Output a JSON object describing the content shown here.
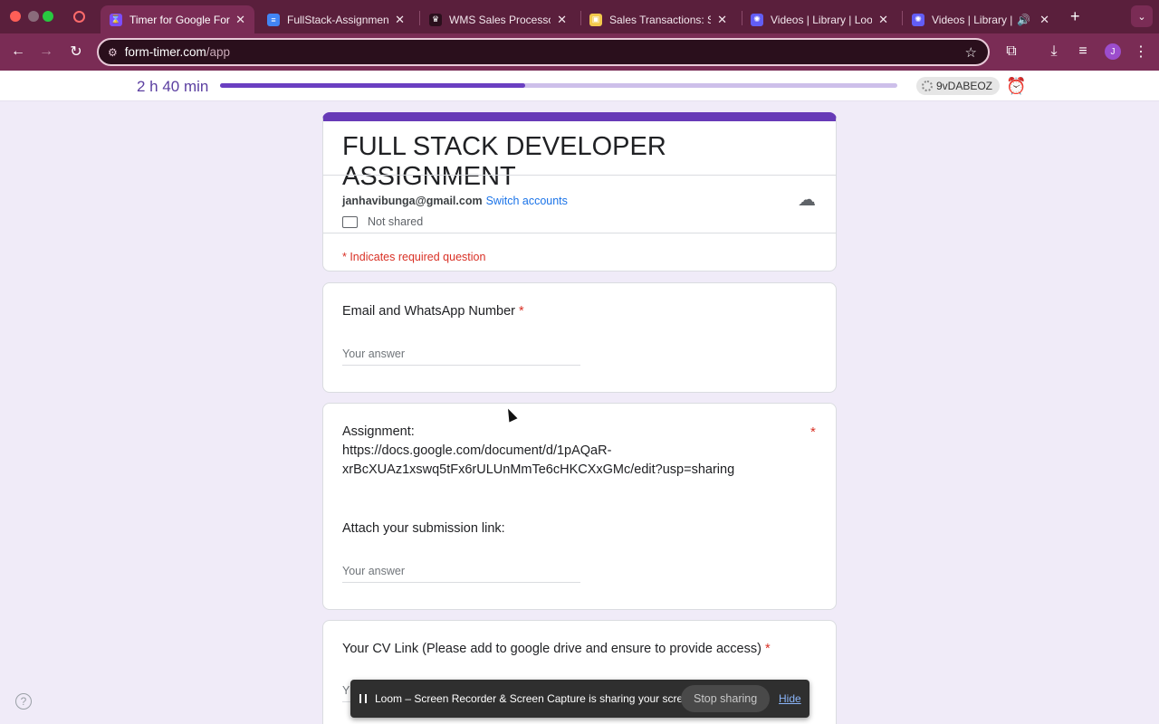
{
  "browser": {
    "tabs": [
      {
        "title": "Timer for Google Forms",
        "favicon": "hourglass-icon",
        "active": true
      },
      {
        "title": "FullStack-Assignment",
        "favicon": "docs-icon",
        "active": false
      },
      {
        "title": "WMS Sales Processor",
        "favicon": "crown-icon",
        "active": false
      },
      {
        "title": "Sales Transactions: Sal",
        "favicon": "box-icon",
        "active": false
      },
      {
        "title": "Videos | Library | Loom",
        "favicon": "loom-icon",
        "active": false
      },
      {
        "title": "Videos | Library | Lo",
        "favicon": "loom-icon",
        "active": false
      }
    ],
    "url_host": "form-timer.com",
    "url_path": "/app",
    "profile_initial": "J"
  },
  "timer": {
    "remaining": "2 h 40 min",
    "progress_fraction": 0.45,
    "code": "9vDABEOZ"
  },
  "form": {
    "title": "FULL STACK DEVELOPER ASSIGNMENT",
    "account_email": "janhavibunga@gmail.com",
    "switch_accounts": "Switch accounts",
    "not_shared": "Not shared",
    "required_note": "* Indicates required question",
    "questions": [
      {
        "title": "Email and WhatsApp Number",
        "required_mark": "*",
        "placeholder": "Your answer"
      },
      {
        "title_line1": "Assignment:",
        "title_line2": "https://docs.google.com/document/d/1pAQaR-",
        "title_line3": "xrBcXUAz1xswq5tFx6rULUnMmTe6cHKCXxGMc/edit?usp=sharing",
        "required_mark": "*",
        "subtitle": "Attach your submission link:",
        "placeholder": "Your answer"
      },
      {
        "title": "Your CV Link (Please add to google drive and ensure to provide access)",
        "required_mark": "*",
        "placeholder": "Y"
      }
    ]
  },
  "loom_banner": {
    "message": "Loom – Screen Recorder & Screen Capture is sharing your screen.",
    "stop_label": "Stop sharing",
    "hide_label": "Hide"
  },
  "colors": {
    "form_accent": "#673ab7",
    "timer_text": "#5b3fa1",
    "required": "#d93025",
    "link": "#1a73e8"
  }
}
